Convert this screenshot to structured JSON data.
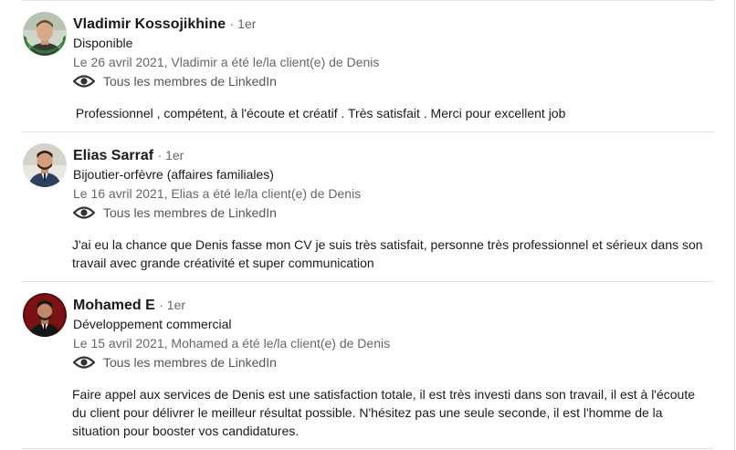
{
  "recommendations": [
    {
      "name": "Vladimir Kossojikhine",
      "degree": "· 1er",
      "headline": "Disponible",
      "meta": "Le 26 avril 2021, Vladimir a été le/la client(e) de Denis",
      "visibility": "Tous les membres de LinkedIn",
      "text": " Professionnel , compétent, à l'écoute et créatif . Très satisfait . Merci pour excellent job",
      "avatar_badge": "#OPENTOWORK",
      "badge_color": "#2e7d32"
    },
    {
      "name": "Elias Sarraf",
      "degree": "· 1er",
      "headline": "Bijoutier-orfèvre (affaires familiales)",
      "meta": "Le 16 avril 2021, Elias a été le/la client(e) de Denis",
      "visibility": "Tous les membres de LinkedIn",
      "text": "J'ai eu la chance que Denis fasse mon CV je suis très satisfait, personne très professionnel et sérieux dans son travail avec grande créativité et super communication"
    },
    {
      "name": "Mohamed E",
      "degree": "· 1er",
      "headline": "Développement commercial",
      "meta": "Le 15 avril 2021, Mohamed a été le/la client(e) de Denis",
      "visibility": "Tous les membres de LinkedIn",
      "text": "Faire appel aux services de Denis est une satisfaction totale, il est très investi dans son travail, il est à l'écoute du client pour délivrer le meilleur résultat possible. N'hésitez pas une seule seconde, il est l'homme de la situation pour booster vos candidatures."
    }
  ],
  "icons": {
    "visibility": "eye-icon"
  },
  "colors": {
    "name_text": "#191919",
    "meta_text": "#666666",
    "divider": "#e4e4e4",
    "open_to_work": "#2e7d32"
  }
}
